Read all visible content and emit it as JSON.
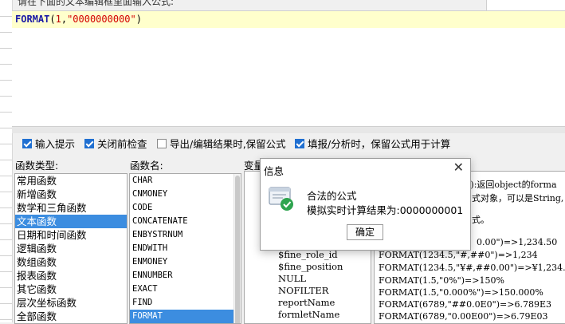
{
  "prompt": "请在下面的文本编辑框里面输入公式:",
  "formula": {
    "func": "FORMAT",
    "open": "(",
    "arg1": "1",
    "comma": ",",
    "arg2": "\"0000000000\"",
    "close": ")"
  },
  "options": [
    {
      "label": "输入提示",
      "checked": true
    },
    {
      "label": "关闭前检查",
      "checked": true
    },
    {
      "label": "导出/编辑结果时,保留公式",
      "checked": false
    },
    {
      "label": "填报/分析时，保留公式用于计算",
      "checked": true
    }
  ],
  "sections": {
    "func_type": "函数类型:",
    "func_name": "函数名:",
    "variables": "变量"
  },
  "func_types": [
    {
      "label": "常用函数",
      "selected": false
    },
    {
      "label": "新增函数",
      "selected": false
    },
    {
      "label": "数学和三角函数",
      "selected": false
    },
    {
      "label": "文本函数",
      "selected": true
    },
    {
      "label": "日期和时间函数",
      "selected": false
    },
    {
      "label": "逻辑函数",
      "selected": false
    },
    {
      "label": "数组函数",
      "selected": false
    },
    {
      "label": "报表函数",
      "selected": false
    },
    {
      "label": "其它函数",
      "selected": false
    },
    {
      "label": "层次坐标函数",
      "selected": false
    },
    {
      "label": "全部函数",
      "selected": false
    }
  ],
  "func_names": [
    {
      "label": "CHAR",
      "selected": false
    },
    {
      "label": "CNMONEY",
      "selected": false
    },
    {
      "label": "CODE",
      "selected": false
    },
    {
      "label": "CONCATENATE",
      "selected": false
    },
    {
      "label": "ENBYSTRNUM",
      "selected": false
    },
    {
      "label": "ENDWITH",
      "selected": false
    },
    {
      "label": "ENMONEY",
      "selected": false
    },
    {
      "label": "ENNUMBER",
      "selected": false
    },
    {
      "label": "EXACT",
      "selected": false
    },
    {
      "label": "FIND",
      "selected": false
    },
    {
      "label": "FORMAT",
      "selected": true
    }
  ],
  "variables": [
    "$fine_role_id",
    "$fine_position",
    "NULL",
    "NOFILTER",
    "reportName",
    "formletName"
  ],
  "description": [
    "t):返回object的forma",
    "式对象，可以是String,",
    "式。",
    "0.00\")=>1,234.50",
    "FORMAT(1234.5,\"#,##0\")=>1,234",
    "FORMAT(1234.5,\"¥#,##0.00\")=>¥1,234.50",
    "FORMAT(1.5,\"0%\")=>150%",
    "FORMAT(1.5,\"0.000%\")=>150.000%",
    "FORMAT(6789,\"##0.0E0\")=>6.789E3",
    "FORMAT(6789,\"0.00E00\")=>6.79E03"
  ],
  "dialog": {
    "title": "信息",
    "message": "合法的公式",
    "detail": "模拟实时计算结果为:0000000001",
    "ok_label": "确定",
    "icon": "valid-formula-icon",
    "accent": "#2ea44f"
  }
}
